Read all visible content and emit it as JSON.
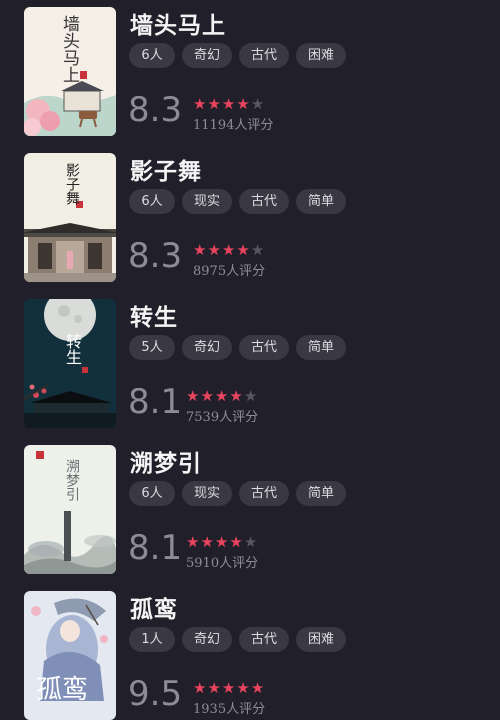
{
  "scripts": [
    {
      "title": "墙头马上",
      "cover_text": "墙头马上",
      "tags": [
        "6人",
        "奇幻",
        "古代",
        "困难"
      ],
      "score": "8.3",
      "stars_filled": 4,
      "stars_total": 5,
      "count": "11194人评分"
    },
    {
      "title": "影子舞",
      "cover_text": "影子舞",
      "tags": [
        "6人",
        "现实",
        "古代",
        "简单"
      ],
      "score": "8.3",
      "stars_filled": 4,
      "stars_total": 5,
      "count": "8975人评分"
    },
    {
      "title": "转生",
      "cover_text": "转生",
      "tags": [
        "5人",
        "奇幻",
        "古代",
        "简单"
      ],
      "score": "8.1",
      "stars_filled": 4,
      "stars_total": 5,
      "count": "7539人评分"
    },
    {
      "title": "溯梦引",
      "cover_text": "溯梦引",
      "tags": [
        "6人",
        "现实",
        "古代",
        "简单"
      ],
      "score": "8.1",
      "stars_filled": 4,
      "stars_total": 5,
      "count": "5910人评分"
    },
    {
      "title": "孤鸾",
      "cover_text": "孤鸾",
      "tags": [
        "1人",
        "奇幻",
        "古代",
        "困难"
      ],
      "score": "9.5",
      "stars_filled": 5,
      "stars_total": 5,
      "count": "1935人评分"
    }
  ],
  "colors": {
    "background": "#211f29",
    "tag_background": "#3a3843",
    "star_active": "#e8445f",
    "star_inactive": "#575663",
    "score_text": "#8c8b96"
  }
}
